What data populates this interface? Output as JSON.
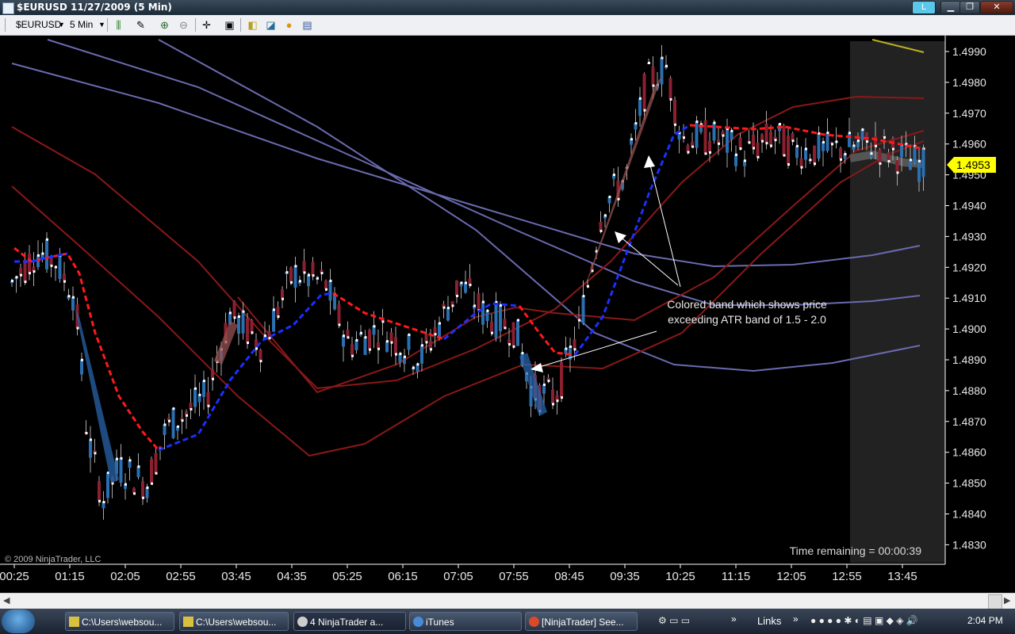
{
  "window": {
    "title": "$EURUSD  11/27/2009 (5 Min)",
    "l_button": "L",
    "minimize": "▁",
    "maximize": "❐",
    "close": "✕"
  },
  "toolbar": {
    "instrument": "$EURUSD",
    "interval": "5 Min"
  },
  "chart": {
    "copyright": "© 2009 NinjaTrader, LLC",
    "time_remaining": "Time remaining = 00:00:39",
    "annotation_line1": "Colored band which shows price",
    "annotation_line2": "exceeding ATR band of 1.5 - 2.0",
    "last_price": "1.4953",
    "y_ticks": [
      "1.4990",
      "1.4980",
      "1.4970",
      "1.4960",
      "1.4950",
      "1.4940",
      "1.4930",
      "1.4920",
      "1.4910",
      "1.4900",
      "1.4890",
      "1.4880",
      "1.4870",
      "1.4860",
      "1.4850",
      "1.4840",
      "1.4830"
    ],
    "x_ticks": [
      "00:25",
      "01:15",
      "02:05",
      "02:55",
      "03:45",
      "04:35",
      "05:25",
      "06:15",
      "07:05",
      "07:55",
      "08:45",
      "09:35",
      "10:25",
      "11:15",
      "12:05",
      "12:55",
      "13:45"
    ]
  },
  "taskbar": {
    "items": [
      "C:\\Users\\websou...",
      "C:\\Users\\websou...",
      "4 NinjaTrader a...",
      "iTunes",
      "[NinjaTrader] See..."
    ],
    "links": "Links",
    "clock": "2:04 PM"
  },
  "colors": {
    "up_candle": "#2a6fb0",
    "down_candle": "#8a2030",
    "ma_up": "#1a30ff",
    "ma_down": "#ff1a1a",
    "atr_band": "#8a1818",
    "long_band": "#6a6ab0",
    "price_badge": "#ffff00"
  }
}
